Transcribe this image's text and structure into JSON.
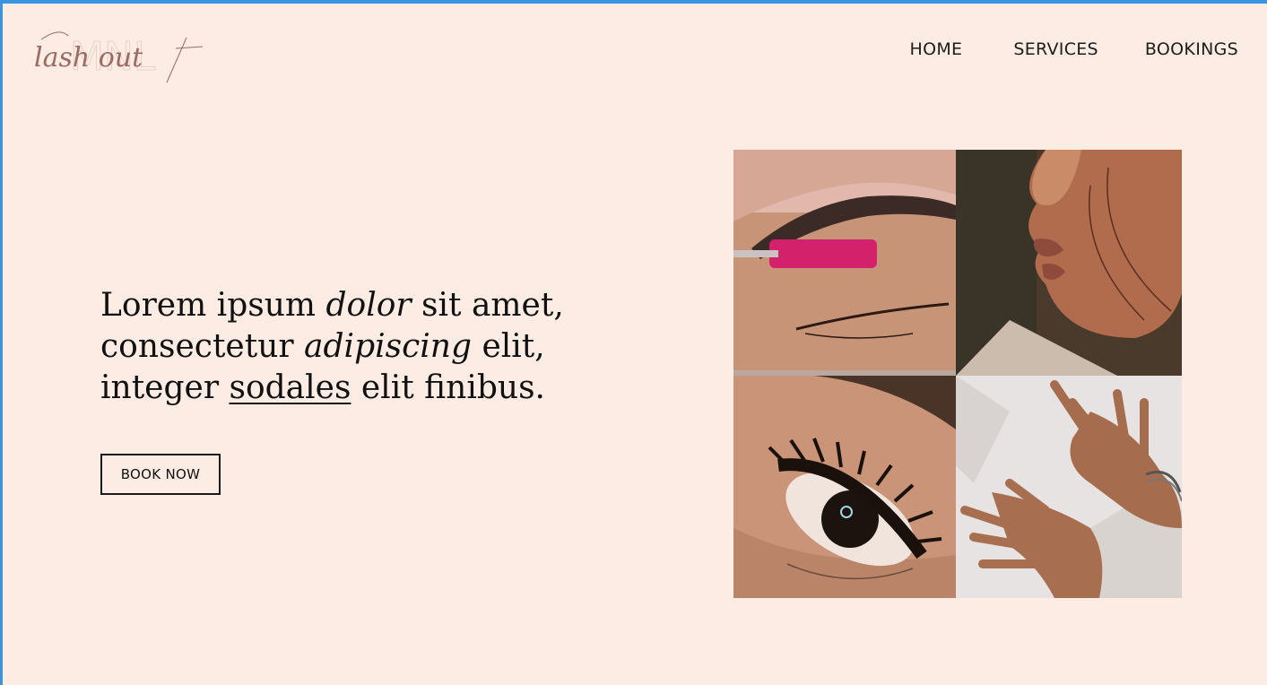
{
  "brand": {
    "logo_script": "lash out",
    "logo_monogram": "MNL"
  },
  "nav": {
    "items": [
      "HOME",
      "SERVICES",
      "BOOKINGS"
    ]
  },
  "hero": {
    "line1_a": "Lorem ipsum ",
    "line1_em": "dolor",
    "line1_b": " sit amet,",
    "line2_a": "consectetur ",
    "line2_em": "adipiscing",
    "line2_b": " elit,",
    "line3_a": "integer ",
    "line3_u": "sodales",
    "line3_b": " elit finibus.",
    "cta_label": "BOOK NOW"
  },
  "gallery": {
    "tiles": [
      "brow-brush-photo",
      "lips-profile-photo",
      "lash-extension-photo",
      "manicure-hands-photo"
    ]
  },
  "colors": {
    "background": "#fdece3",
    "frame_accent": "#3a94e0",
    "logo_ink": "#9a6a63",
    "text": "#111111"
  }
}
